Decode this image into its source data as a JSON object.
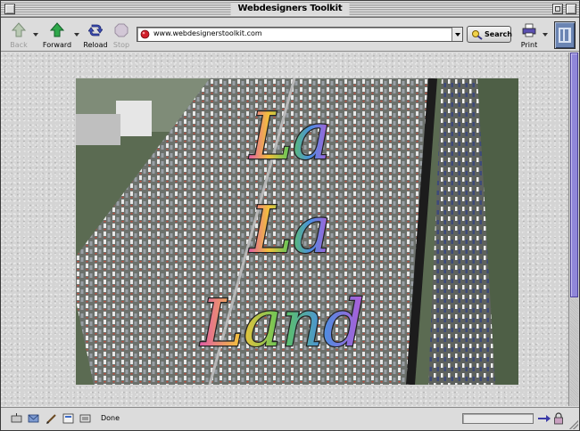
{
  "window": {
    "title": "Webdesigners Toolkit"
  },
  "toolbar": {
    "back_label": "Back",
    "forward_label": "Forward",
    "reload_label": "Reload",
    "stop_label": "Stop",
    "search_label": "Search",
    "print_label": "Print"
  },
  "address": {
    "url": "www.webdesignerstoolkit.com"
  },
  "content": {
    "image_description_words": [
      "La",
      "La",
      "Land"
    ]
  },
  "status": {
    "text": "Done"
  },
  "colors": {
    "scroll_thumb": "#8f86d8",
    "throbber": "#6b85b3",
    "page_background": "#d4d4d4"
  },
  "icons": [
    "back-arrow-icon",
    "forward-arrow-icon",
    "reload-icon",
    "stop-icon",
    "search-icon",
    "print-icon",
    "browser-logo-icon"
  ]
}
